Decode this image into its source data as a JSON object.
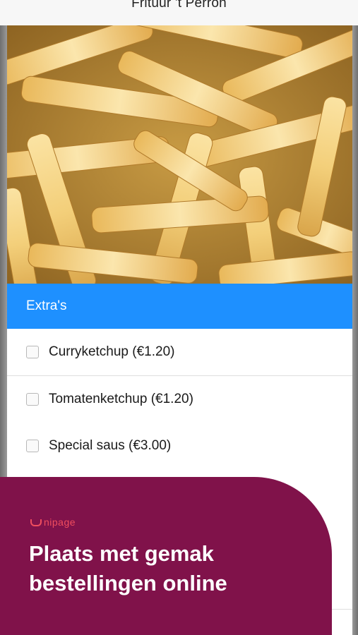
{
  "header": {
    "title": "Frituur 't Perron"
  },
  "hero": {
    "image_icon": "fries-photo"
  },
  "extras": {
    "title": "Extra's",
    "options": [
      {
        "label": "Curryketchup (€1.20)",
        "checked": false
      },
      {
        "label": "Tomatenketchup (€1.20)",
        "checked": false
      },
      {
        "label": "Special saus (€3.00)",
        "checked": false
      }
    ]
  },
  "promo": {
    "brand": "nipage",
    "headline_line1": "Plaats met gemak",
    "headline_line2": "bestellingen online"
  },
  "colors": {
    "accent": "#1e90ff",
    "promo_bg": "#80124a",
    "brand": "#f04e5e"
  }
}
